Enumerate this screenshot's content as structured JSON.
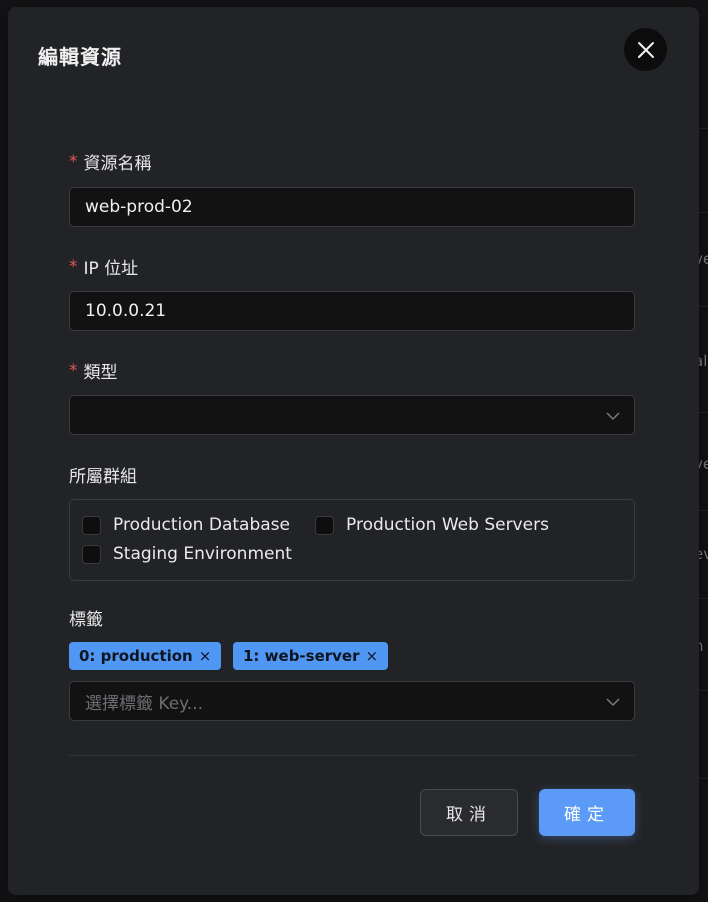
{
  "modal": {
    "title": "編輯資源",
    "close_icon": "close-icon"
  },
  "fields": {
    "name": {
      "label": "資源名稱",
      "required": "*",
      "value": "web-prod-02"
    },
    "ip": {
      "label": "IP 位址",
      "required": "*",
      "value": "10.0.0.21"
    },
    "type": {
      "label": "類型",
      "required": "*",
      "value": ""
    }
  },
  "groups": {
    "label": "所屬群組",
    "options": [
      {
        "label": "Production Database",
        "checked": false
      },
      {
        "label": "Production Web Servers",
        "checked": false
      },
      {
        "label": "Staging Environment",
        "checked": false
      }
    ]
  },
  "tags": {
    "label": "標籤",
    "items": [
      {
        "label": "0: production",
        "remove": "×"
      },
      {
        "label": "1: web-server",
        "remove": "×"
      }
    ],
    "select_placeholder": "選擇標籤 Key..."
  },
  "buttons": {
    "cancel": "取消",
    "confirm": "確定"
  },
  "background_fragments": [
    "!",
    "ve",
    "al",
    "ve",
    "ev",
    "h"
  ],
  "colors": {
    "accent": "#5b9bf7",
    "tag": "#4f97f2",
    "required": "#e05656"
  }
}
